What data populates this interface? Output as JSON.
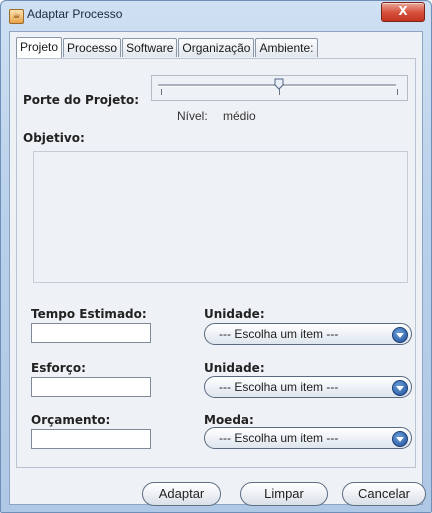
{
  "window": {
    "title": "Adaptar Processo",
    "close_label": "X"
  },
  "tabs": [
    {
      "label": "Projeto",
      "active": true
    },
    {
      "label": "Processo",
      "active": false
    },
    {
      "label": "Software",
      "active": false
    },
    {
      "label": "Organização",
      "active": false
    },
    {
      "label": "Ambiente:",
      "active": false
    }
  ],
  "projeto": {
    "porte_label": "Porte do Projeto:",
    "slider_level": 0.5,
    "nivel_label": "Nível:",
    "nivel_value": "médio",
    "objetivo_label": "Objetivo:",
    "objetivo_value": "",
    "tempo_label": "Tempo Estimado:",
    "tempo_value": "",
    "tempo_unidade_label": "Unidade:",
    "tempo_unidade_value": "--- Escolha um item ---",
    "esforco_label": "Esforço:",
    "esforco_value": "",
    "esforco_unidade_label": "Unidade:",
    "esforco_unidade_value": "--- Escolha um item ---",
    "orcamento_label": "Orçamento:",
    "orcamento_value": "",
    "moeda_label": "Moeda:",
    "moeda_value": "--- Escolha um item ---"
  },
  "buttons": {
    "adaptar": "Adaptar",
    "limpar": "Limpar",
    "cancelar": "Cancelar"
  }
}
